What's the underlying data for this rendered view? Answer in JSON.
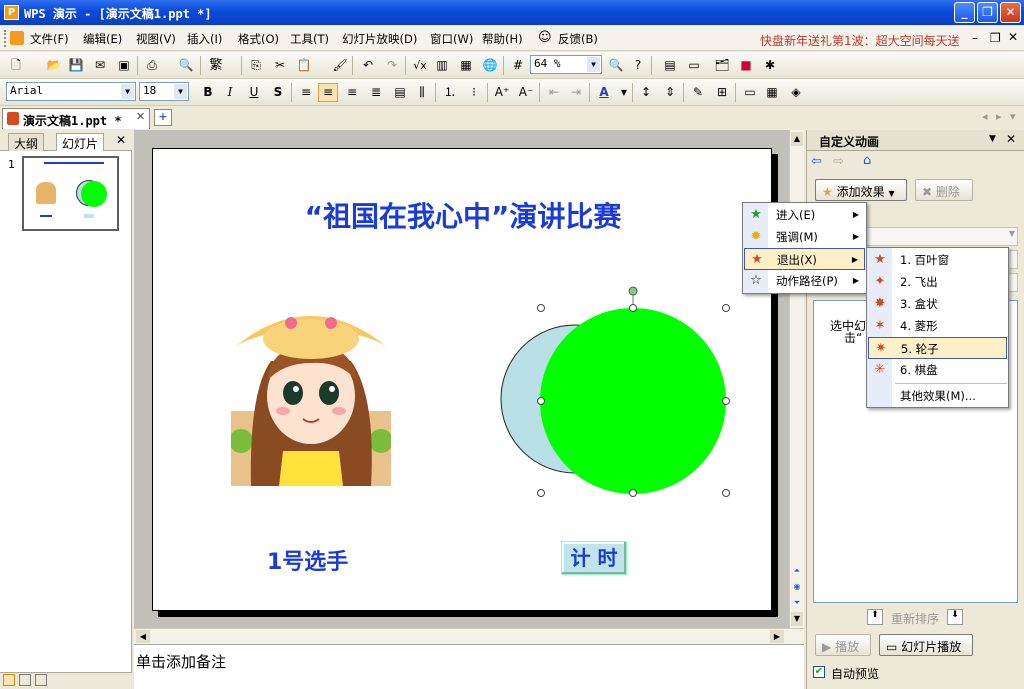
{
  "window": {
    "title": "WPS 演示 - [演示文稿1.ppt *]",
    "logo": "P"
  },
  "menus": [
    "文件(F)",
    "编辑(E)",
    "视图(V)",
    "插入(I)",
    "格式(O)",
    "工具(T)",
    "幻灯片放映(D)",
    "窗口(W)",
    "帮助(H)"
  ],
  "feedback": "反馈(B)",
  "promo": "快盘新年送礼第1波：超大空间每天送",
  "toolbar": {
    "zoom": "64 %",
    "font": "Arial",
    "size": "18"
  },
  "tabs": {
    "doc": "演示文稿1.ppt *"
  },
  "left": {
    "tab_outline": "大纲",
    "tab_slides": "幻灯片",
    "slide_number": "1"
  },
  "slide": {
    "title": "“祖国在我心中”演讲比赛",
    "player": "1号选手",
    "timer": "计 时"
  },
  "notes": {
    "placeholder": "单击添加备注"
  },
  "taskpane": {
    "title": "自定义动画",
    "add_effect": "添加效果",
    "delete": "删除",
    "hint_line1": "选中幻",
    "hint_line2": "击“",
    "reorder": "重新排序",
    "play": "播放",
    "slideshow": "幻灯片播放",
    "autopreview": "自动预览",
    "autopreview_checked": true
  },
  "menu": {
    "items": [
      {
        "label": "进入(E)",
        "icon": "enter-star-icon"
      },
      {
        "label": "强调(M)",
        "icon": "emphasis-star-icon"
      },
      {
        "label": "退出(X)",
        "icon": "exit-star-icon",
        "highlighted": true
      },
      {
        "label": "动作路径(P)",
        "icon": "motion-path-icon"
      }
    ]
  },
  "submenu": {
    "items": [
      "1. 百叶窗",
      "2. 飞出",
      "3. 盒状",
      "4. 菱形",
      "5. 轮子",
      "6. 棋盘"
    ],
    "highlighted_index": 4,
    "more": "其他效果(M)..."
  },
  "colors": {
    "title_blue": "#1a3bd6",
    "green_circle": "#00ff00",
    "back_circle": "#b8dfe3",
    "xp_blue": "#0a4ad8"
  }
}
